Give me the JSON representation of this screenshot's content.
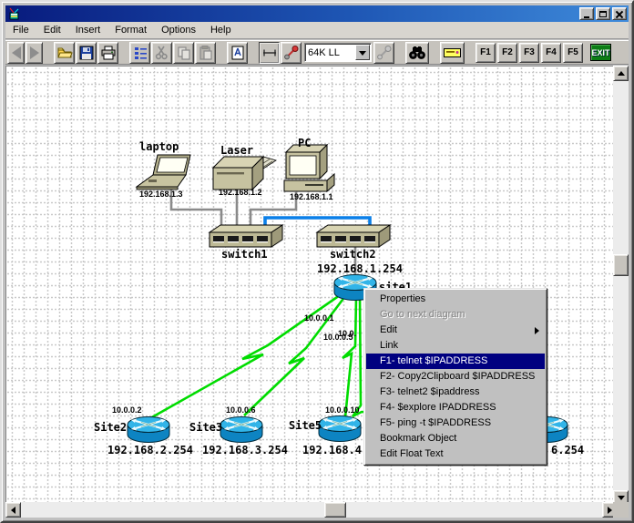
{
  "window": {
    "title": "",
    "controls": [
      "minimize-icon",
      "maximize-icon",
      "close-icon"
    ]
  },
  "menubar": {
    "items": [
      "File",
      "Edit",
      "Insert",
      "Format",
      "Options",
      "Help"
    ]
  },
  "toolbar": {
    "icons": [
      "back-icon",
      "forward-icon",
      "open-folder-icon",
      "save-floppy-icon",
      "print-icon",
      "properties-list-icon",
      "cut-scissors-icon",
      "copy-icon",
      "paste-icon",
      "text-page-icon",
      "draw-line-tool-icon",
      "add-link-tool-icon",
      "link-disabled-icon",
      "find-binoculars-icon",
      "float-text-icon",
      "exit-icon"
    ],
    "line_type_value": "64K LL",
    "fn_buttons": [
      "F1",
      "F2",
      "F3",
      "F4",
      "F5"
    ],
    "exit_label": "EXIT"
  },
  "context_menu": {
    "items": [
      {
        "label": "Properties",
        "state": "normal"
      },
      {
        "label": "Go to next diagram",
        "state": "disabled"
      },
      {
        "label": "Edit",
        "state": "normal",
        "submenu": true
      },
      {
        "label": "Link",
        "state": "normal"
      },
      {
        "label": "F1- telnet $IPADDRESS",
        "state": "selected"
      },
      {
        "label": "F2- Copy2Clipboard $IPADDRESS",
        "state": "normal"
      },
      {
        "label": "F3- telnet2 $ipaddress",
        "state": "normal"
      },
      {
        "label": "F4- $explore IPADDRESS",
        "state": "normal"
      },
      {
        "label": "F5- ping -t $IPADDRESS",
        "state": "normal"
      },
      {
        "label": "Bookmark Object",
        "state": "normal"
      },
      {
        "label": "Edit Float Text",
        "state": "normal"
      }
    ]
  },
  "diagram": {
    "laptop": {
      "name": "laptop",
      "ip": "192.168.1.3"
    },
    "printer": {
      "name": "Laser",
      "ip": "192.168.1.2"
    },
    "pc": {
      "name": "PC",
      "ip": "192.168.1.1"
    },
    "switch1": {
      "name": "switch1"
    },
    "switch2": {
      "name": "switch2"
    },
    "site1": {
      "name": "site1",
      "ip": "192.168.1.254"
    },
    "site2": {
      "name": "Site2",
      "ip": "192.168.2.254",
      "link_near": "10.0.0.1",
      "link_far": "10.0.0.2"
    },
    "site3": {
      "name": "Site3",
      "ip": "192.168.3.254",
      "link_near": "10.0.0.5",
      "link_far": "10.0.0.6"
    },
    "site5": {
      "name": "Site5",
      "ip_visible": "192.168.4",
      "link_near_visible": "10.0.",
      "link_far": "10.0.0.10"
    },
    "site6": {
      "ip_visible": "6.254"
    }
  },
  "colors": {
    "selection": "#000080",
    "serial_link_green": "#00dc00",
    "ethernet_blue": "#0a7fe8",
    "cable_gray": "#8a8a8a",
    "router_cyan": "#31b4e8",
    "device_beige": "#c6c2a0",
    "titlebar_left": "#081b7e",
    "titlebar_right": "#3e8ada",
    "exit_green": "#0c7c14"
  }
}
